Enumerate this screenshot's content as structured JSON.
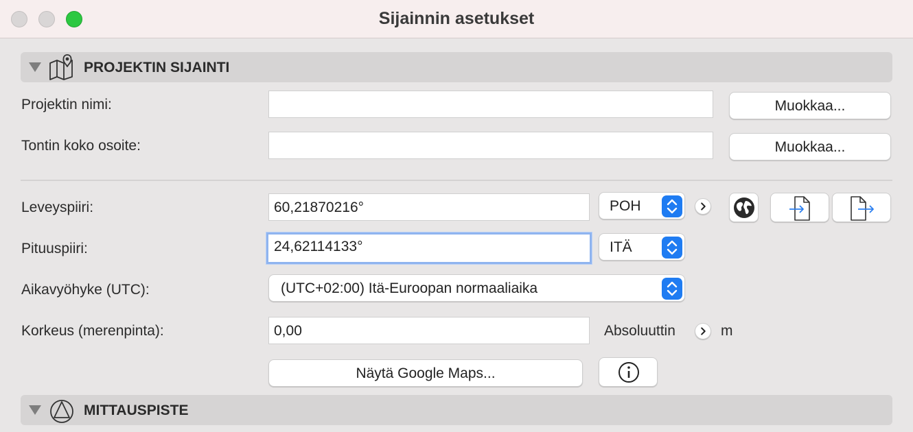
{
  "window": {
    "title": "Sijainnin asetukset"
  },
  "section_location": {
    "title": "PROJEKTIN SIJAINTI"
  },
  "project_name": {
    "label": "Projektin nimi:",
    "value": "",
    "edit_label": "Muokkaa..."
  },
  "site_address": {
    "label": "Tontin koko osoite:",
    "value": "",
    "edit_label": "Muokkaa..."
  },
  "latitude": {
    "label": "Leveyspiiri:",
    "value": "60,21870216°",
    "direction": "POH"
  },
  "longitude": {
    "label": "Pituuspiiri:",
    "value": "24,62114133°",
    "direction": "ITÄ"
  },
  "timezone": {
    "label": "Aikavyöhyke (UTC):",
    "value": "(UTC+02:00) Itä-Euroopan normaaliaika"
  },
  "elevation": {
    "label": "Korkeus (merenpinta):",
    "value": "0,00",
    "reference": "Absoluuttin",
    "unit": "m"
  },
  "maps_button": {
    "label": "Näytä Google Maps..."
  },
  "section_survey": {
    "title": "MITTAUSPISTE"
  }
}
